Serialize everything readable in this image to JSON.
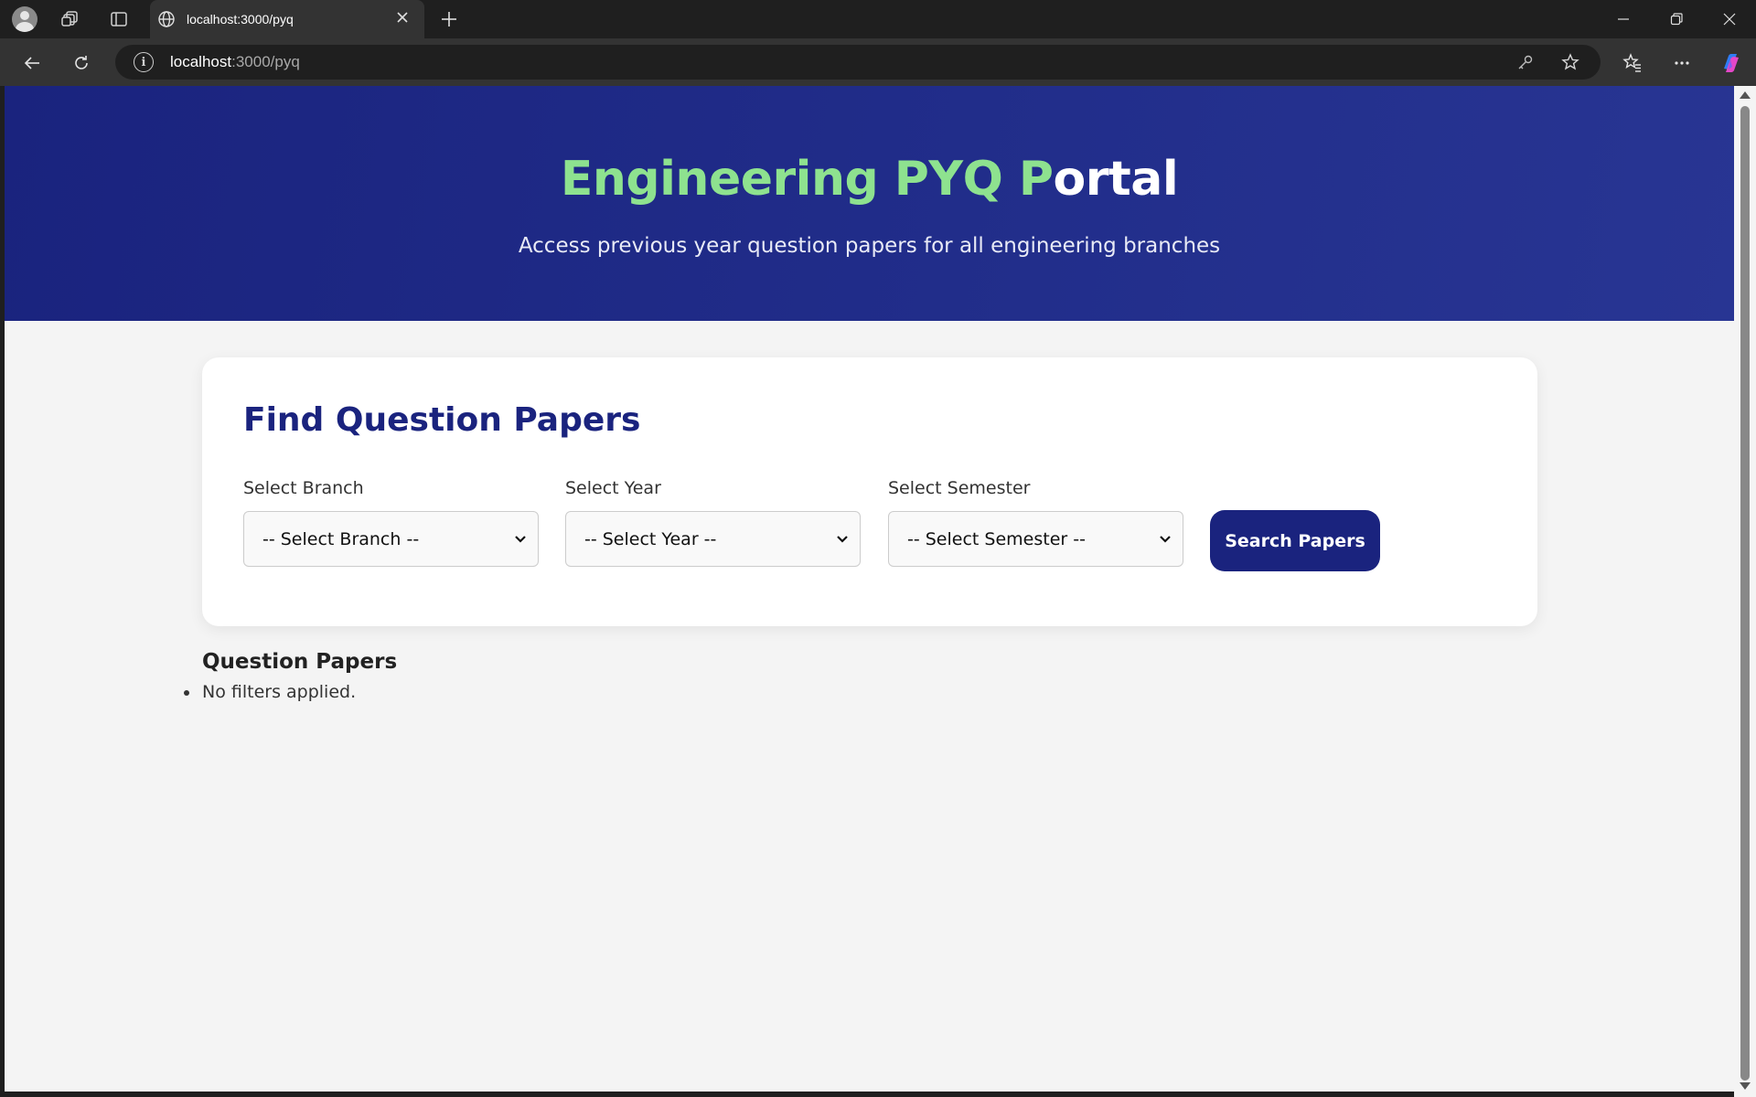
{
  "browser": {
    "tab_title": "localhost:3000/pyq",
    "url_host": "localhost",
    "url_path": ":3000/pyq"
  },
  "hero": {
    "title_highlight": "Engineering PYQ P",
    "title_rest": "ortal",
    "subtitle": "Access previous year question papers for all engineering branches"
  },
  "search_card": {
    "title": "Find Question Papers",
    "branch": {
      "label": "Select Branch",
      "selected": "-- Select Branch --"
    },
    "year": {
      "label": "Select Year",
      "selected": "-- Select Year --"
    },
    "semester": {
      "label": "Select Semester",
      "selected": "-- Select Semester --"
    },
    "search_button": "Search Papers"
  },
  "results": {
    "heading": "Question Papers",
    "items": [
      "No filters applied."
    ]
  },
  "colors": {
    "brand_navy": "#1a237e",
    "title_green": "#8ee28f",
    "page_bg": "#f4f4f4"
  },
  "icons": [
    "profile-icon",
    "workspaces-icon",
    "tab-actions-icon",
    "globe-icon",
    "close-icon",
    "new-tab-icon",
    "minimize-icon",
    "restore-icon",
    "back-icon",
    "refresh-icon",
    "info-icon",
    "key-icon",
    "star-icon",
    "favorites-icon",
    "more-icon",
    "copilot-icon",
    "chevron-down-icon"
  ]
}
